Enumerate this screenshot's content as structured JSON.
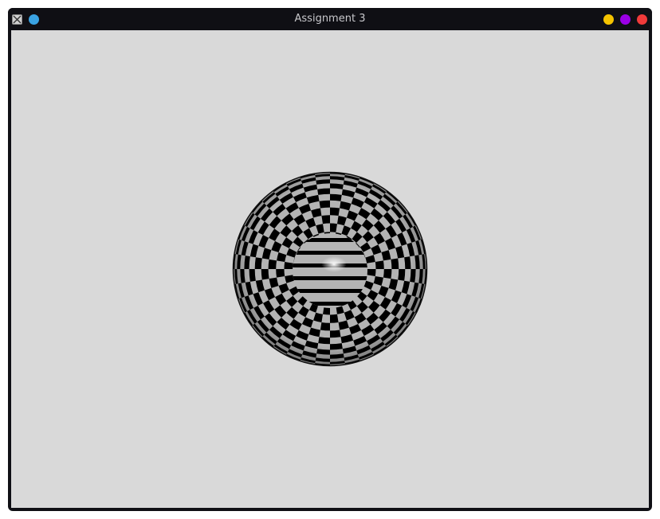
{
  "window": {
    "title": "Assignment 3"
  },
  "titlebar": {
    "app_icon": "x-window-icon",
    "left_button": {
      "icon": "sticky-dot-icon",
      "color": "#3aa3e3"
    },
    "right_buttons": [
      {
        "icon": "minimize-dot-icon",
        "color": "#f5c400"
      },
      {
        "icon": "maximize-dot-icon",
        "color": "#9b00e6"
      },
      {
        "icon": "close-dot-icon",
        "color": "#f03a3a"
      }
    ]
  },
  "scene": {
    "background_color": "#d9d9d9",
    "object": "checkered-sphere",
    "check_color_dark": "#000000",
    "check_color_light": "#b4b4b4"
  }
}
